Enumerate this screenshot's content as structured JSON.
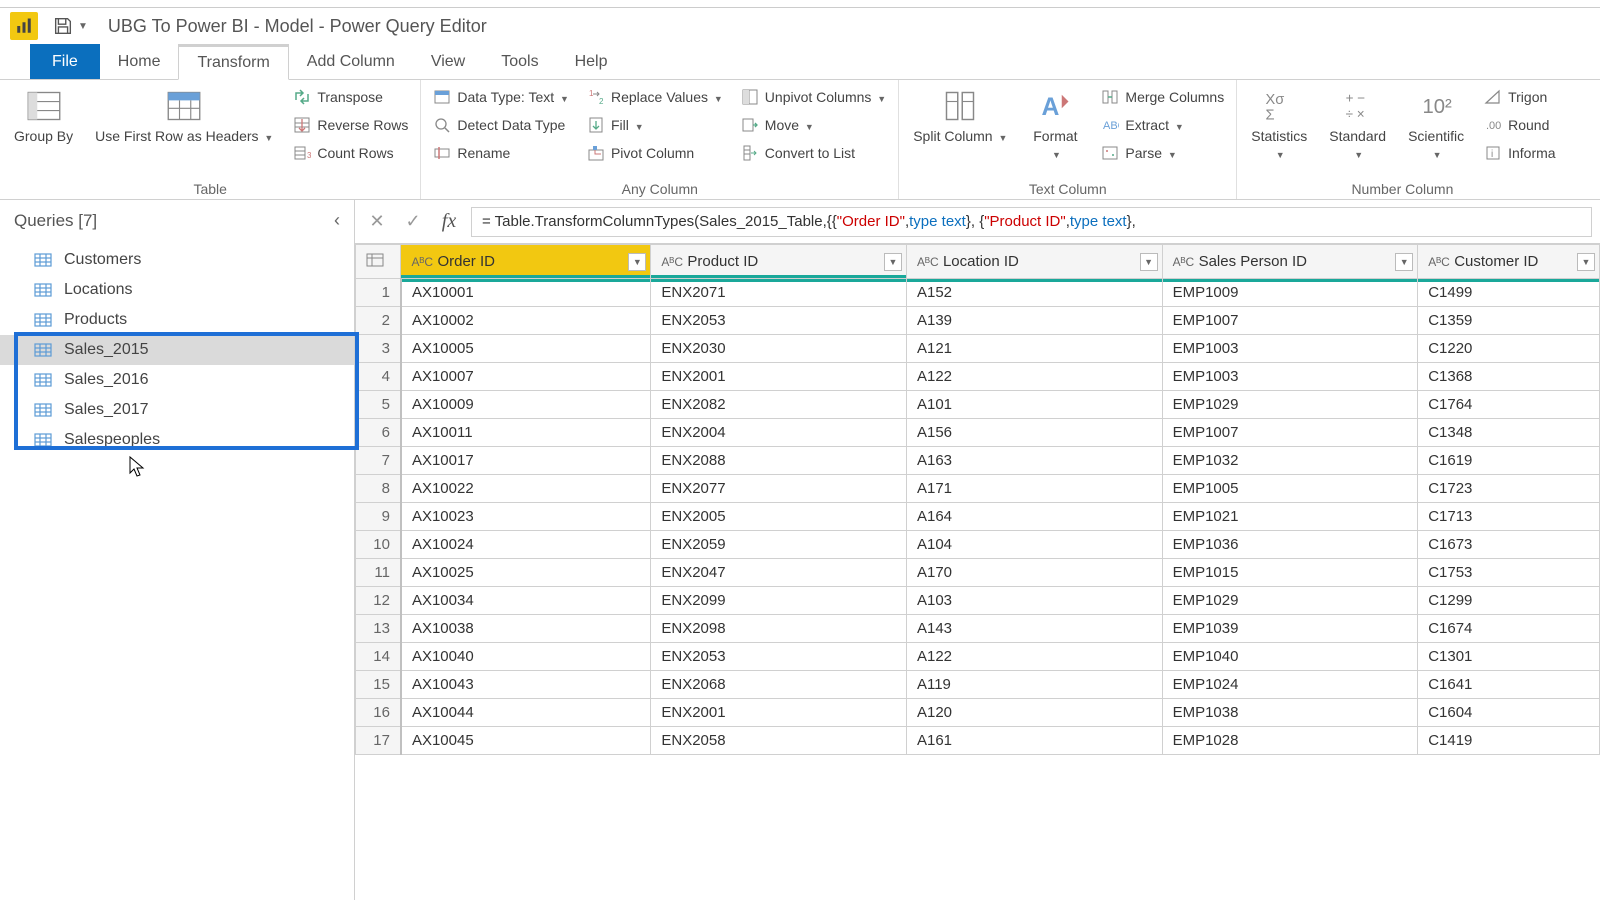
{
  "window": {
    "title": "UBG To Power BI - Model - Power Query Editor"
  },
  "tabs": {
    "file": "File",
    "home": "Home",
    "transform": "Transform",
    "addcol": "Add Column",
    "view": "View",
    "tools": "Tools",
    "help": "Help"
  },
  "ribbon": {
    "table": {
      "groupby": "Group\nBy",
      "usefirst": "Use First Row\nas Headers",
      "transpose": "Transpose",
      "reverse": "Reverse Rows",
      "count": "Count Rows",
      "label": "Table"
    },
    "anycol": {
      "datatype": "Data Type: Text",
      "detect": "Detect Data Type",
      "rename": "Rename",
      "replace": "Replace Values",
      "fill": "Fill",
      "pivot": "Pivot Column",
      "unpivot": "Unpivot Columns",
      "move": "Move",
      "convert": "Convert to List",
      "label": "Any Column"
    },
    "textcol": {
      "split": "Split\nColumn",
      "format": "Format",
      "merge": "Merge Columns",
      "extract": "Extract",
      "parse": "Parse",
      "label": "Text Column"
    },
    "numcol": {
      "stats": "Statistics",
      "standard": "Standard",
      "scientific": "Scientific",
      "trig": "Trigon",
      "round": "Round",
      "info": "Informa",
      "label": "Number Column"
    }
  },
  "queries": {
    "header": "Queries [7]",
    "items": [
      "Customers",
      "Locations",
      "Products",
      "Sales_2015",
      "Sales_2016",
      "Sales_2017",
      "Salespeoples"
    ]
  },
  "formula": {
    "pre": "= Table.TransformColumnTypes(Sales_2015_Table,{{",
    "s1": "\"Order ID\"",
    "mid1": ", ",
    "t1": "type text",
    "mid2": "}, {",
    "s2": "\"Product ID\"",
    "mid3": ", ",
    "t2": "type text",
    "end": "},"
  },
  "columns": [
    "Order ID",
    "Product ID",
    "Location ID",
    "Sales Person ID",
    "Customer ID"
  ],
  "typeIcon": "AᴮC",
  "rows": [
    [
      "AX10001",
      "ENX2071",
      "A152",
      "EMP1009",
      "C1499"
    ],
    [
      "AX10002",
      "ENX2053",
      "A139",
      "EMP1007",
      "C1359"
    ],
    [
      "AX10005",
      "ENX2030",
      "A121",
      "EMP1003",
      "C1220"
    ],
    [
      "AX10007",
      "ENX2001",
      "A122",
      "EMP1003",
      "C1368"
    ],
    [
      "AX10009",
      "ENX2082",
      "A101",
      "EMP1029",
      "C1764"
    ],
    [
      "AX10011",
      "ENX2004",
      "A156",
      "EMP1007",
      "C1348"
    ],
    [
      "AX10017",
      "ENX2088",
      "A163",
      "EMP1032",
      "C1619"
    ],
    [
      "AX10022",
      "ENX2077",
      "A171",
      "EMP1005",
      "C1723"
    ],
    [
      "AX10023",
      "ENX2005",
      "A164",
      "EMP1021",
      "C1713"
    ],
    [
      "AX10024",
      "ENX2059",
      "A104",
      "EMP1036",
      "C1673"
    ],
    [
      "AX10025",
      "ENX2047",
      "A170",
      "EMP1015",
      "C1753"
    ],
    [
      "AX10034",
      "ENX2099",
      "A103",
      "EMP1029",
      "C1299"
    ],
    [
      "AX10038",
      "ENX2098",
      "A143",
      "EMP1039",
      "C1674"
    ],
    [
      "AX10040",
      "ENX2053",
      "A122",
      "EMP1040",
      "C1301"
    ],
    [
      "AX10043",
      "ENX2068",
      "A119",
      "EMP1024",
      "C1641"
    ],
    [
      "AX10044",
      "ENX2001",
      "A120",
      "EMP1038",
      "C1604"
    ],
    [
      "AX10045",
      "ENX2058",
      "A161",
      "EMP1028",
      "C1419"
    ]
  ]
}
